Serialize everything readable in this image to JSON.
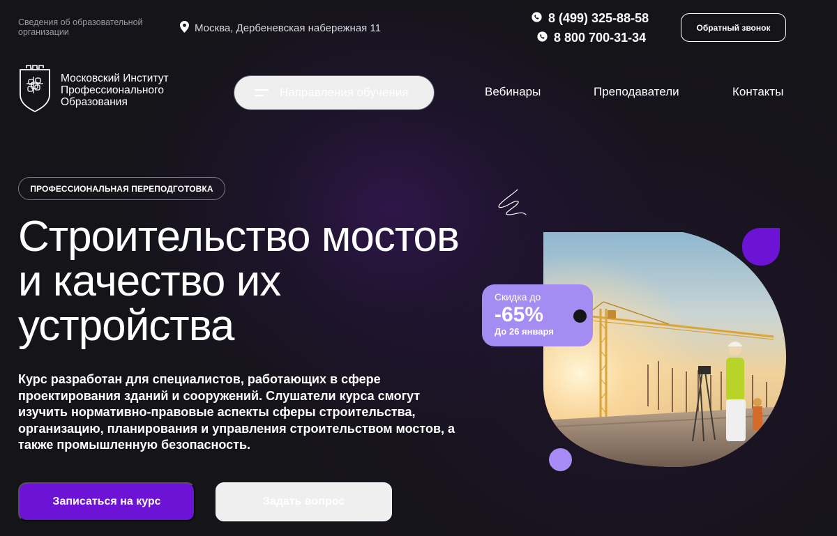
{
  "topbar": {
    "org_info": "Сведения об образовательной организации",
    "address": "Москва, Дербеневская набережная 11",
    "phone_1": "8 (499) 325-88-58",
    "phone_2": "8 800 700-31-34",
    "callback_label": "Обратный звонок"
  },
  "logo": {
    "text": "Московский Институт Профессионального Образования"
  },
  "nav": {
    "directions_label": "Направления обучения",
    "webinars": "Вебинары",
    "teachers": "Преподаватели",
    "contacts": "Контакты"
  },
  "hero": {
    "badge": "ПРОФЕССИОНАЛЬНАЯ ПЕРЕПОДГОТОВКА",
    "title": "Строительство мостов и качество их устройства",
    "description": "Курс разработан для специалистов, работающих в сфере проектирования зданий и сооружений. Слушатели курса смогут изучить нормативно-правовые аспекты сферы строительства, организацию, планирования и управления строительством мостов, а также промышленную безопасность.",
    "enroll_label": "Записаться на курс",
    "ask_label": "Задать вопрос"
  },
  "discount": {
    "label": "Скидка до",
    "value": "-65%",
    "date": "До 26 января"
  },
  "colors": {
    "accent": "#6d13d6",
    "lavender": "#a58cf2",
    "background": "#151419"
  }
}
